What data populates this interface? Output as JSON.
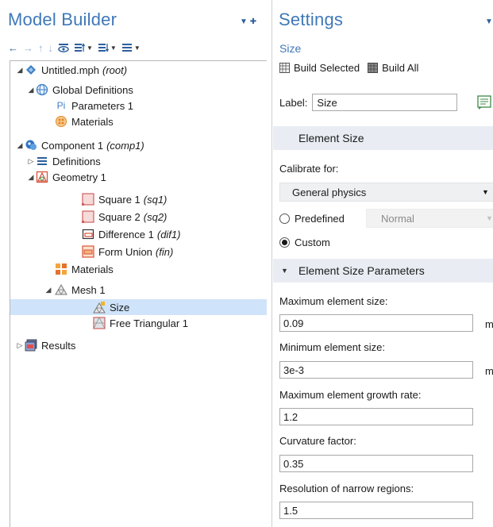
{
  "model_builder": {
    "title": "Model Builder",
    "tree": [
      {
        "label": "Untitled.mph",
        "tag": "(root)",
        "icon": "model-file-icon"
      },
      {
        "label": "Global Definitions",
        "icon": "globe-icon"
      },
      {
        "label": "Parameters 1",
        "icon": "parameters-icon",
        "icon_text": "Pi"
      },
      {
        "label": "Materials",
        "icon": "material-icon"
      },
      {
        "label": "Component 1",
        "tag": "(comp1)",
        "icon": "component-icon"
      },
      {
        "label": "Definitions",
        "icon": "definitions-icon"
      },
      {
        "label": "Geometry 1",
        "icon": "geometry-icon"
      },
      {
        "label": "Square 1",
        "tag": "(sq1)",
        "icon": "square-icon"
      },
      {
        "label": "Square 2",
        "tag": "(sq2)",
        "icon": "square-icon"
      },
      {
        "label": "Difference 1",
        "tag": "(dif1)",
        "icon": "difference-icon"
      },
      {
        "label": "Form Union",
        "tag": "(fin)",
        "icon": "form-union-icon"
      },
      {
        "label": "Materials",
        "icon": "materials-icon"
      },
      {
        "label": "Mesh 1",
        "icon": "mesh-icon"
      },
      {
        "label": "Size",
        "icon": "size-icon",
        "selected": true
      },
      {
        "label": "Free Triangular 1",
        "icon": "free-triangular-icon"
      },
      {
        "label": "Results",
        "icon": "results-icon"
      }
    ]
  },
  "settings": {
    "title": "Settings",
    "subtitle": "Size",
    "build_selected": "Build Selected",
    "build_all": "Build All",
    "label_caption": "Label:",
    "label_value": "Size",
    "element_size": {
      "header": "Element Size",
      "calibrate_label": "Calibrate for:",
      "calibrate_value": "General physics",
      "predefined_label": "Predefined",
      "predefined_value": "Normal",
      "custom_label": "Custom",
      "selected_option": "Custom"
    },
    "parameters": {
      "header": "Element Size Parameters",
      "max_size_label": "Maximum element size:",
      "max_size_value": "0.09",
      "max_size_unit": "m",
      "min_size_label": "Minimum element size:",
      "min_size_value": "3e-3",
      "min_size_unit": "m",
      "growth_rate_label": "Maximum element growth rate:",
      "growth_rate_value": "1.2",
      "curvature_label": "Curvature factor:",
      "curvature_value": "0.35",
      "narrow_label": "Resolution of narrow regions:",
      "narrow_value": "1.5"
    }
  },
  "colors": {
    "title_blue": "#3f78b8",
    "selection": "#cfe4fa",
    "section_bar": "#e9edf3"
  }
}
